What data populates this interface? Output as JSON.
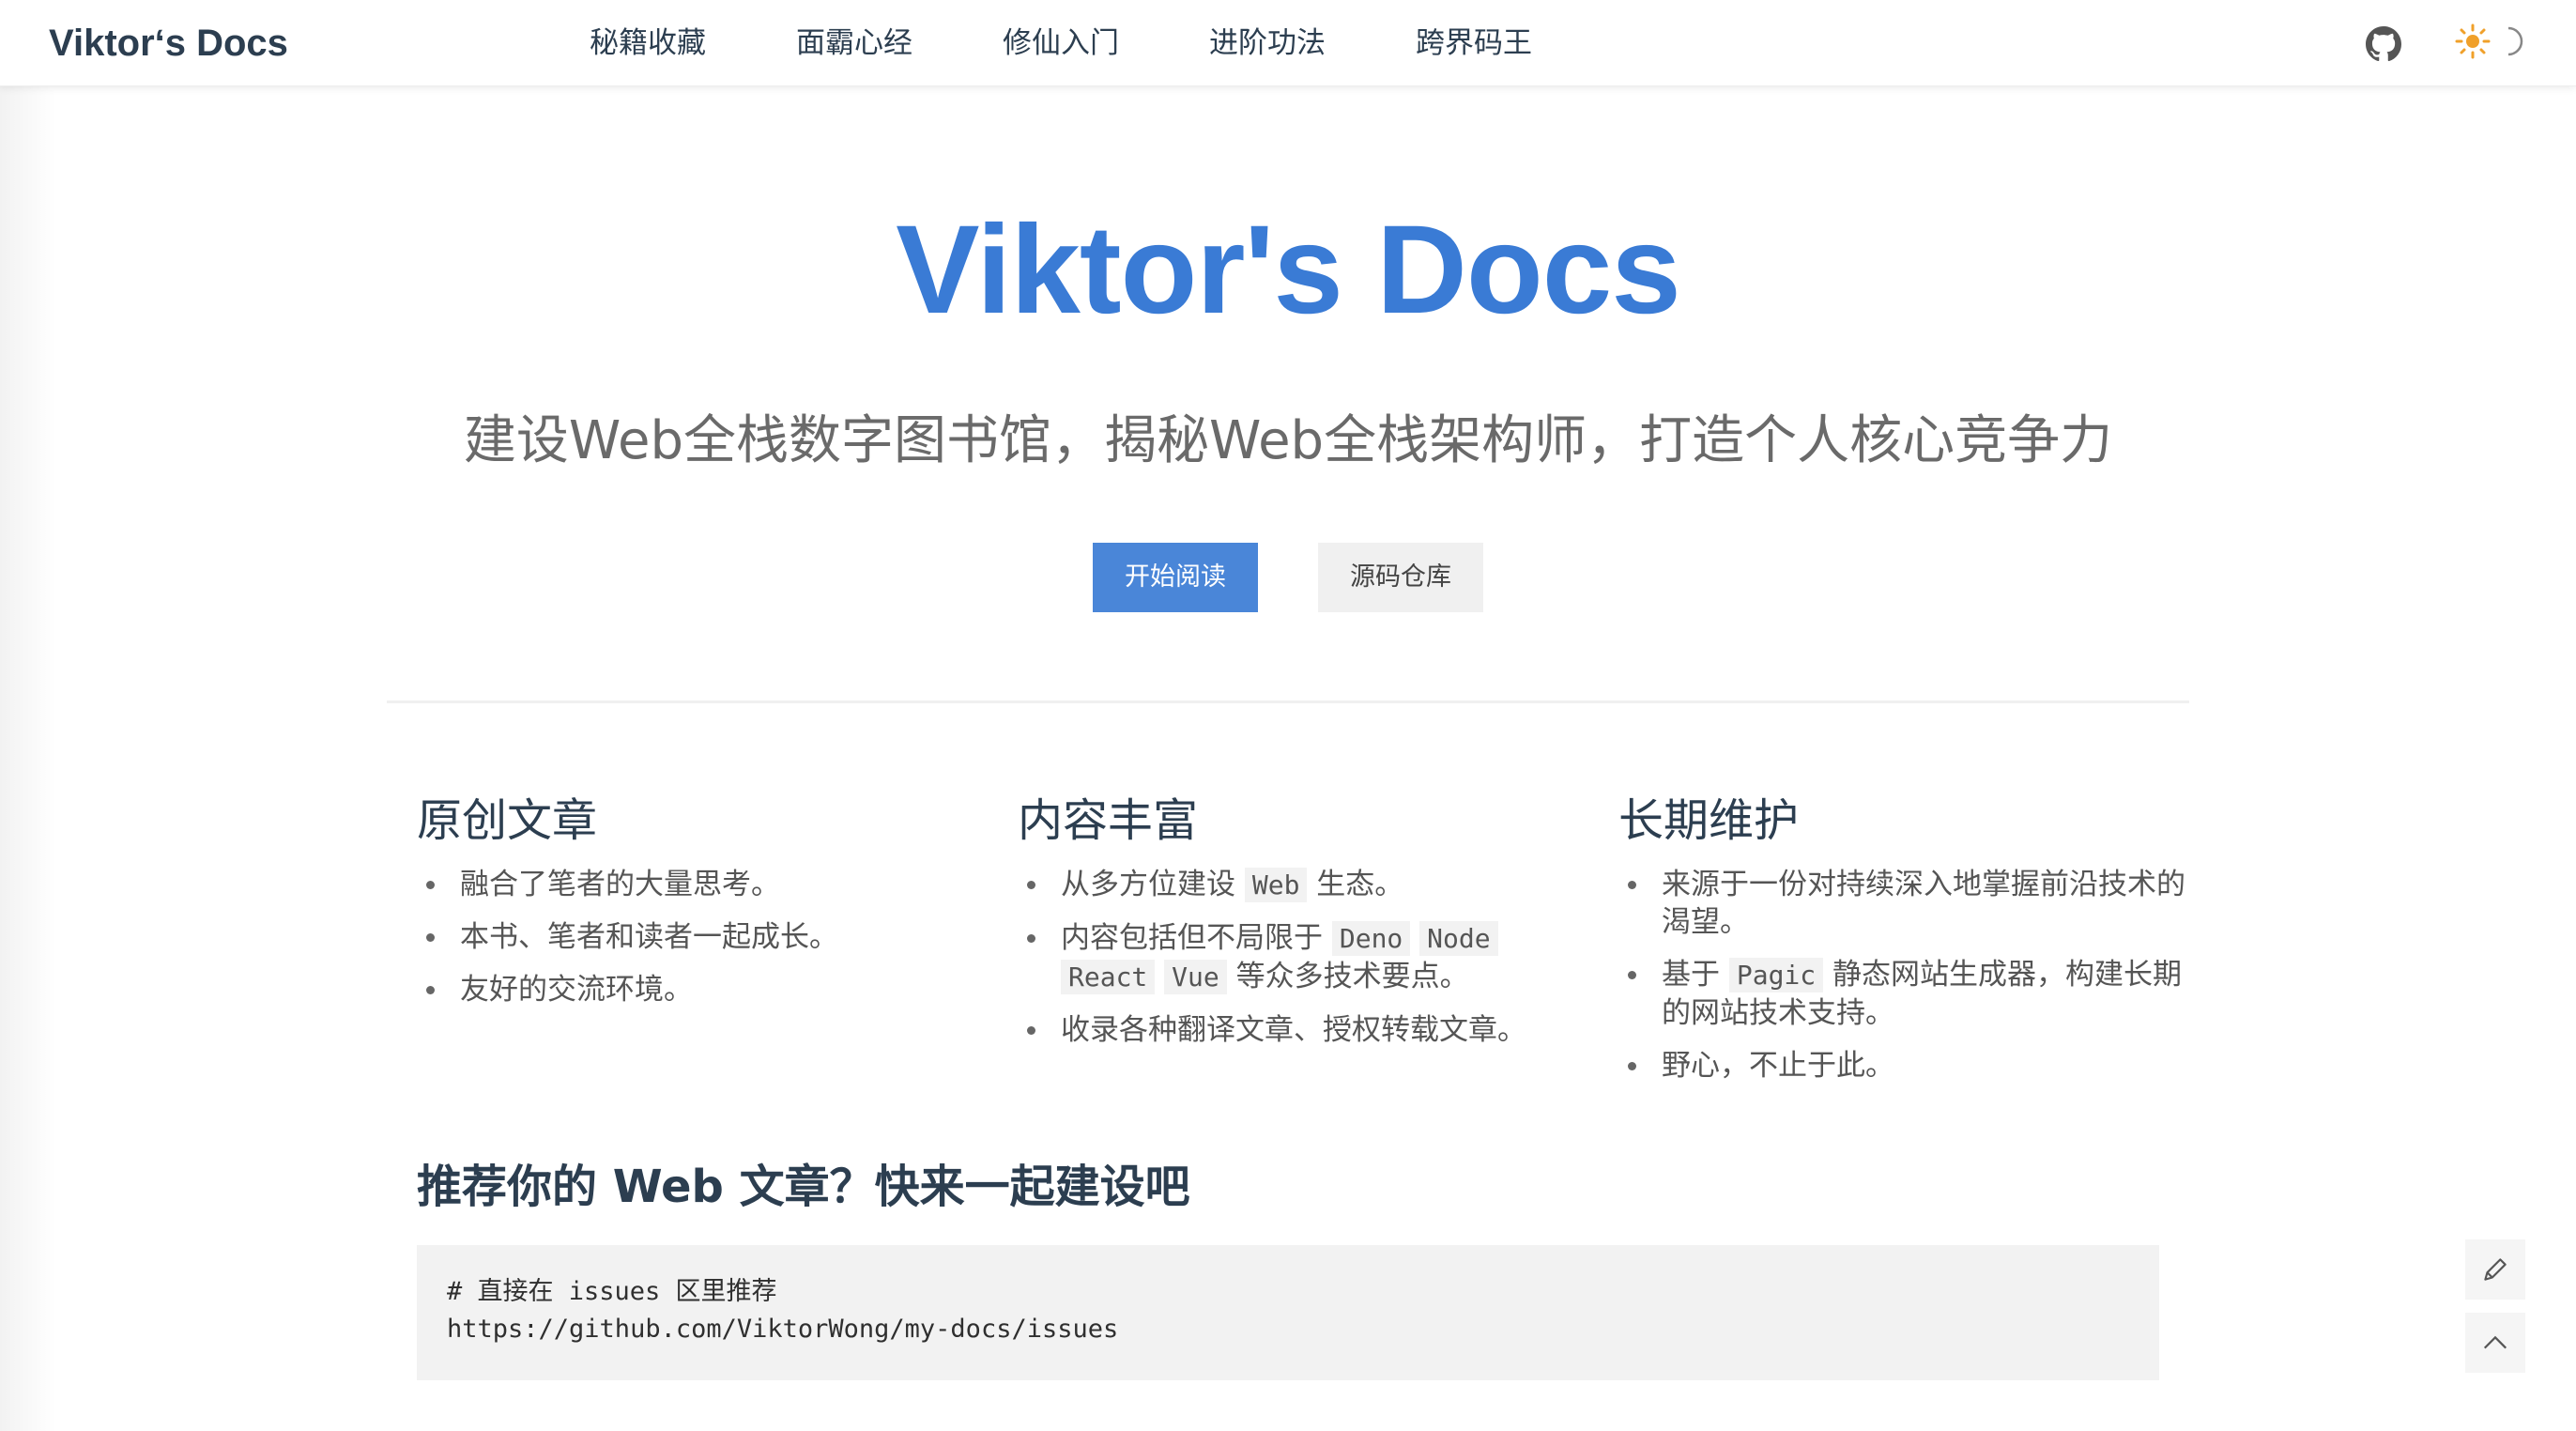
{
  "navbar": {
    "brand": "Viktor‘s Docs",
    "links": [
      "秘籍收藏",
      "面霸心经",
      "修仙入门",
      "进阶功法",
      "跨界码王"
    ],
    "icons": [
      "github-icon",
      "sun-icon",
      "moon-icon"
    ]
  },
  "hero": {
    "title": "Viktor's Docs",
    "tagline": "建设Web全栈数字图书馆，揭秘Web全栈架构师，打造个人核心竞争力",
    "primary_button": "开始阅读",
    "secondary_button": "源码仓库"
  },
  "features": [
    {
      "title": "原创文章",
      "items": [
        {
          "text": "融合了笔者的大量思考。"
        },
        {
          "text": "本书、笔者和读者一起成长。"
        },
        {
          "text": "友好的交流环境。"
        }
      ]
    },
    {
      "title": "内容丰富",
      "items": [
        {
          "pre": "从多方位建设",
          "code": "Web",
          "post": "生态。"
        },
        {
          "pre": "内容包括但不局限于",
          "codes": [
            "Deno",
            "Node",
            "React",
            "Vue"
          ],
          "post": "等众多技术要点。"
        },
        {
          "text": "收录各种翻译文章、授权转载文章。"
        }
      ]
    },
    {
      "title": "长期维护",
      "items": [
        {
          "text": "来源于一份对持续深入地掌握前沿技术的渴望。"
        },
        {
          "pre": "基于",
          "code": "Pagic",
          "post": "静态网站生成器，构建长期的网站技术支持。"
        },
        {
          "text": "野心，不止于此。"
        }
      ]
    }
  ],
  "recommend": {
    "title": "推荐你的 Web 文章？快来一起建设吧",
    "code_lines": [
      "# 直接在 issues 区里推荐",
      "https://github.com/ViktorWong/my-docs/issues"
    ]
  },
  "colors": {
    "accent": "#3a7bd5",
    "button": "#4a86d8",
    "sun": "#f0a02a"
  },
  "tools": [
    "edit-icon",
    "back-to-top-icon"
  ]
}
